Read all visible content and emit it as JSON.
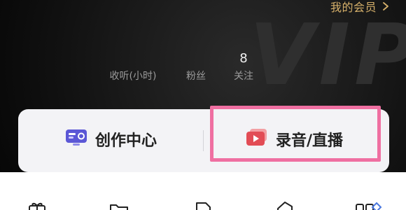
{
  "header": {
    "member_label": "我的会员",
    "chevron_icon": "chevron-right-icon",
    "watermark": "VIP"
  },
  "stats": [
    {
      "value": "",
      "label": "收听(小时)"
    },
    {
      "value": "",
      "label": "粉丝"
    },
    {
      "value": "8",
      "label": "关注"
    }
  ],
  "card": {
    "create_label": "创作中心",
    "create_icon": "creator-center-icon",
    "record_label": "录音/直播",
    "record_icon": "record-live-icon"
  },
  "colors": {
    "gold": "#d6b06a",
    "highlight": "#ef6fa1",
    "card_bg": "#f3f3f6",
    "create_icon_bg": "#5b57d6",
    "record_icon_bg": "#e24c55"
  },
  "bottom_icons": [
    "gift-icon",
    "folder-icon",
    "document-icon",
    "tag-icon",
    "apps-icon"
  ]
}
